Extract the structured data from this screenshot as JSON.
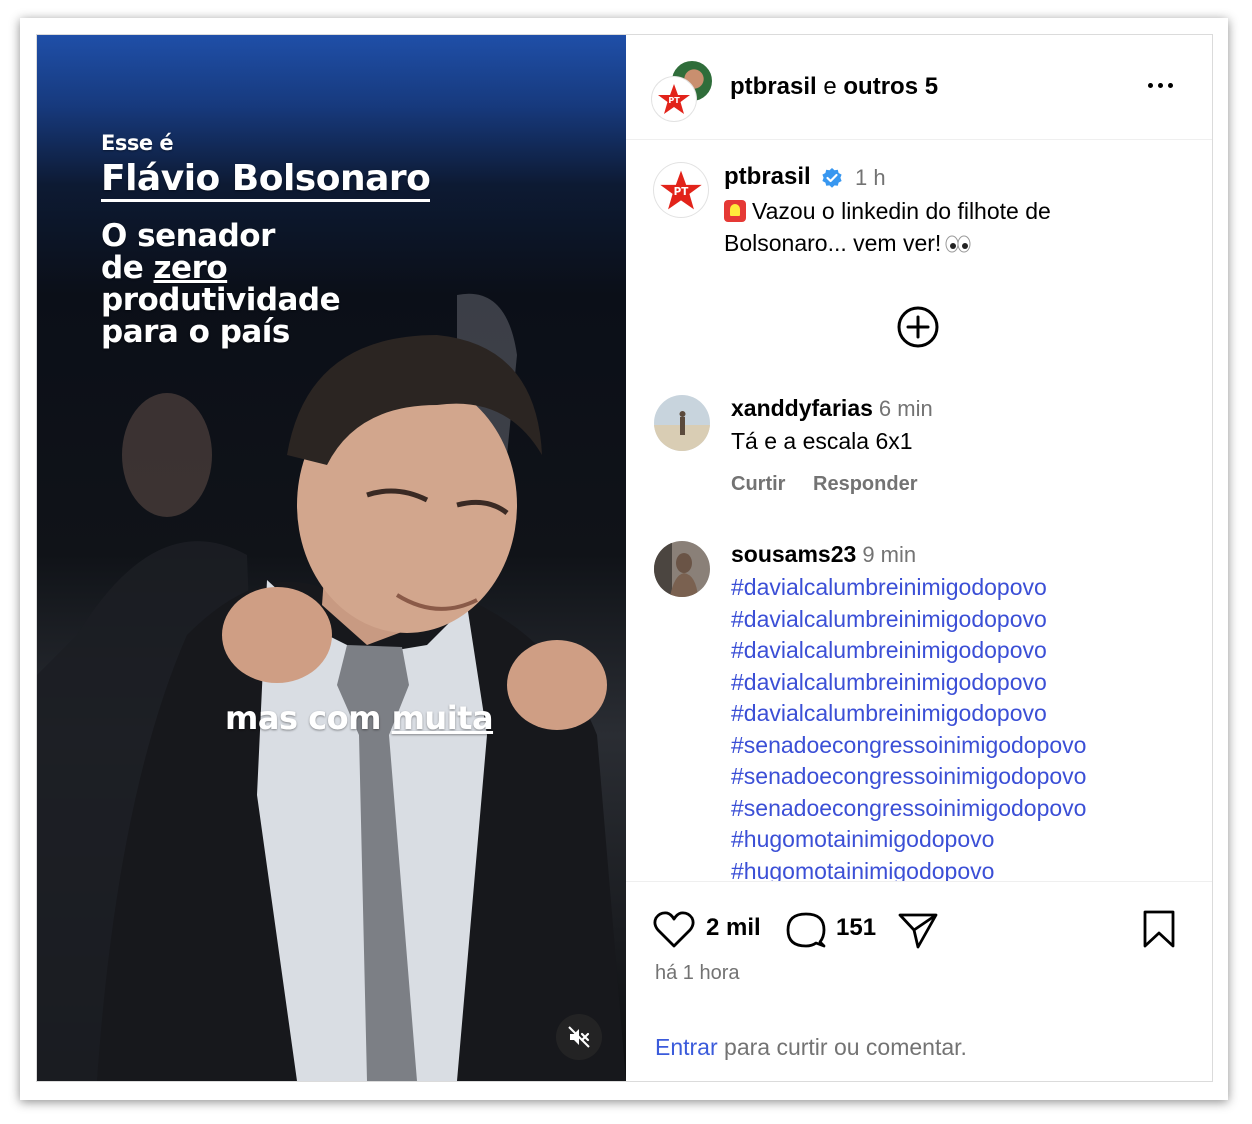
{
  "media": {
    "overlay": {
      "line_intro": "Esse é",
      "line_name": "Flávio Bolsonaro",
      "line1": "O senador",
      "line2_prefix": "de ",
      "line2_underlined": "zero",
      "line3": "produtividade",
      "line4": "para o país",
      "bottom_prefix": "mas com ",
      "bottom_underlined": "muita"
    },
    "mute_icon": "speaker-muted-icon"
  },
  "header": {
    "username": "ptbrasil",
    "connector": "e",
    "others": "outros 5",
    "more_icon": "more-horizontal-icon"
  },
  "caption": {
    "username": "ptbrasil",
    "time": "1 h",
    "text": "Vazou o linkedin do filhote de Bolsonaro... vem ver!",
    "verified_color": "#3897f0"
  },
  "load_more_icon": "plus-circle-icon",
  "comments": [
    {
      "username": "xanddyfarias",
      "time": "6 min",
      "text": "Tá e a escala 6x1",
      "like_label": "Curtir",
      "reply_label": "Responder"
    },
    {
      "username": "sousams23",
      "time": "9 min",
      "hashtags": [
        "#davialcalumbreinimigodopovo",
        "#davialcalumbreinimigodopovo",
        "#davialcalumbreinimigodopovo",
        "#davialcalumbreinimigodopovo",
        "#davialcalumbreinimigodopovo",
        "#senadoecongressoinimigodopovo",
        "#senadoecongressoinimigodopovo",
        "#senadoecongressoinimigodopovo",
        "#hugomotainimigodopovo",
        "#hugomotainimigodopovo"
      ]
    }
  ],
  "footer": {
    "likes": "2 mil",
    "comments": "151",
    "time": "há 1 hora",
    "login_link": "Entrar",
    "login_text": "para curtir ou comentar."
  },
  "colors": {
    "link": "#3b5bdb",
    "hashtag": "#3b4fd6",
    "secondary_text": "#737373",
    "pt_red": "#e2231a"
  }
}
